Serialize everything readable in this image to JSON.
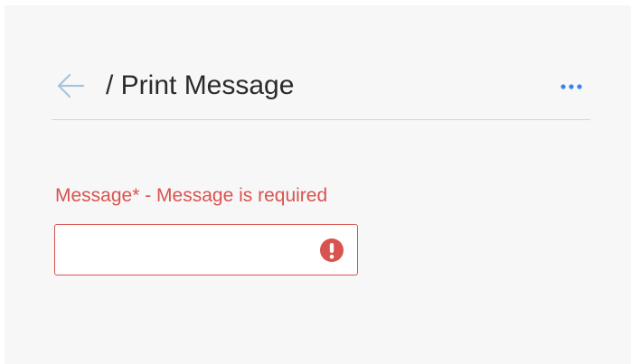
{
  "header": {
    "back_icon": "back-arrow-icon",
    "title": "/ Print Message",
    "more_icon": "more-horizontal-icon"
  },
  "form": {
    "message_label": "Message* - Message is required",
    "message_value": "",
    "message_placeholder": "",
    "error_icon": "error-exclamation-icon"
  },
  "colors": {
    "error": "#d9534f",
    "accent": "#3b82f6",
    "back_arrow": "#a9c3de",
    "divider": "#c9d9e8",
    "panel_background": "#f7f7f7"
  }
}
